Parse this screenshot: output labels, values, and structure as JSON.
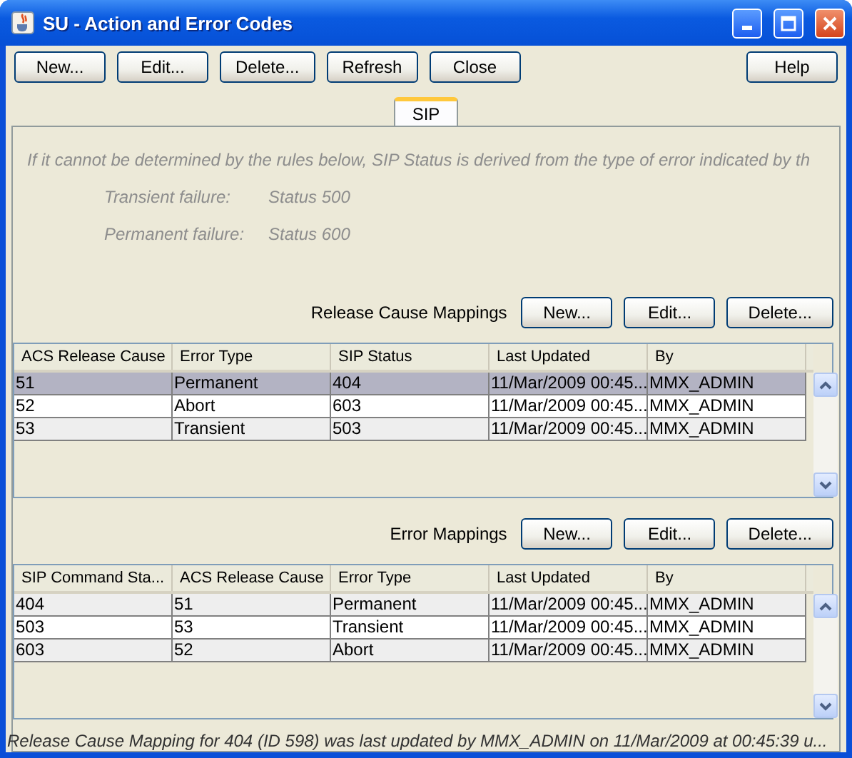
{
  "window": {
    "title": "SU - Action and Error Codes"
  },
  "toolbar": {
    "buttons": [
      "New...",
      "Edit...",
      "Delete...",
      "Refresh",
      "Close"
    ],
    "help": "Help"
  },
  "tabs": [
    {
      "label": "SIP",
      "selected": true
    }
  ],
  "intro": "If it cannot be determined by the rules below, SIP Status is derived from the type of error indicated by th",
  "defaults": [
    {
      "label": "Transient failure:",
      "value": "Status 500"
    },
    {
      "label": "Permanent failure:",
      "value": "Status 600"
    }
  ],
  "sections": [
    {
      "title": "Release Cause Mappings",
      "buttons": [
        "New...",
        "Edit...",
        "Delete..."
      ],
      "table": {
        "columns": [
          "ACS Release Cause",
          "Error Type",
          "SIP Status",
          "Last Updated",
          "By"
        ],
        "rows": [
          {
            "cells": [
              "51",
              "Permanent",
              "404",
              "11/Mar/2009 00:45...",
              "MMX_ADMIN"
            ],
            "selected": true
          },
          {
            "cells": [
              "52",
              "Abort",
              "603",
              "11/Mar/2009 00:45...",
              "MMX_ADMIN"
            ],
            "selected": false
          },
          {
            "cells": [
              "53",
              "Transient",
              "503",
              "11/Mar/2009 00:45...",
              "MMX_ADMIN"
            ],
            "selected": false
          }
        ]
      }
    },
    {
      "title": "Error Mappings",
      "buttons": [
        "New...",
        "Edit...",
        "Delete..."
      ],
      "table": {
        "columns": [
          "SIP Command Sta...",
          "ACS Release Cause",
          "Error Type",
          "Last Updated",
          "By"
        ],
        "rows": [
          {
            "cells": [
              "404",
              "51",
              "Permanent",
              "11/Mar/2009 00:45...",
              "MMX_ADMIN"
            ],
            "selected": false
          },
          {
            "cells": [
              "503",
              "53",
              "Transient",
              "11/Mar/2009 00:45...",
              "MMX_ADMIN"
            ],
            "selected": false
          },
          {
            "cells": [
              "603",
              "52",
              "Abort",
              "11/Mar/2009 00:45...",
              "MMX_ADMIN"
            ],
            "selected": false
          }
        ]
      }
    }
  ],
  "status_bar": "Release Cause Mapping for 404 (ID 598) was last updated by MMX_ADMIN on 11/Mar/2009 at 00:45:39 u..."
}
